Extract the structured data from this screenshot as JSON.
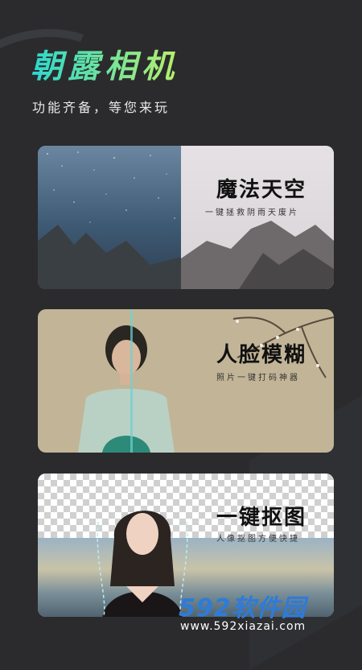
{
  "header": {
    "app_title": "朝露相机",
    "subtitle": "功能齐备，等您来玩"
  },
  "features": [
    {
      "title": "魔法天空",
      "desc": "一键拯救阴雨天废片"
    },
    {
      "title": "人脸模糊",
      "desc": "照片一键打码神器"
    },
    {
      "title": "一键抠图",
      "desc": "人像抠图方便快捷"
    }
  ],
  "watermark": {
    "brand": "592软件园",
    "url": "www.592xiazai.com"
  },
  "colors": {
    "background": "#2b2b2d",
    "title_gradient_start": "#2ad8d0",
    "title_gradient_end": "#b7f06a",
    "watermark_blue": "#2e7bd9"
  }
}
